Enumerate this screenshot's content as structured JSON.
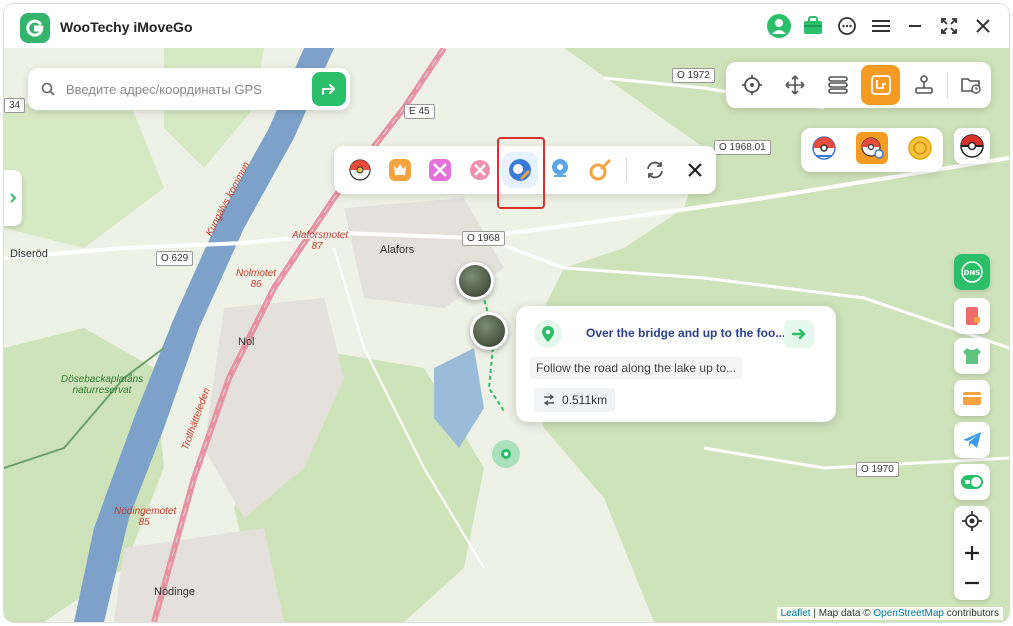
{
  "app": {
    "title": "WooTechy iMoveGo"
  },
  "search": {
    "placeholder": "Введите адрес/координаты GPS"
  },
  "map": {
    "places": [
      {
        "name": "Diseröd",
        "style": "plain"
      },
      {
        "name": "Alafors",
        "style": "plain"
      },
      {
        "name": "Nol",
        "style": "plain"
      },
      {
        "name": "Nödinge",
        "style": "plain"
      },
      {
        "name": "Alaforsmotet 87",
        "style": "red"
      },
      {
        "name": "Nolmotet 86",
        "style": "red"
      },
      {
        "name": "Nödingemotet 85",
        "style": "red"
      },
      {
        "name": "Kungälvs kommun",
        "style": "red"
      },
      {
        "name": "Dösebackaplatåns naturreservat",
        "style": "green"
      },
      {
        "name": "Trollhätteleden",
        "style": "red"
      }
    ],
    "road_badges": [
      "O 1972",
      "E 45",
      "O 1968.01",
      "O 1968",
      "O 629",
      "O 1970",
      "34"
    ]
  },
  "info_card": {
    "title": "Over the bridge and up to the foo...",
    "description": "Follow the road along the lake up to...",
    "distance": "0.511km"
  },
  "attribution": {
    "leaflet": "Leaflet",
    "map_data": " | Map data © ",
    "osm": "OpenStreetMap",
    "contributors": " contributors"
  },
  "colors": {
    "brand_green": "#2bbf6a",
    "active_mode": "#f59a23",
    "highlight_red": "#d9312b",
    "water": "#7da2c9",
    "forest": "#c9dfb4"
  },
  "icons": {
    "titlebar": [
      "avatar-icon",
      "shop-icon",
      "chat-icon",
      "menu-icon",
      "minimize-icon",
      "fullscreen-icon",
      "close-icon"
    ],
    "modes": [
      "teleport-icon",
      "move-icon",
      "multi-spot-icon",
      "jump-route-icon",
      "joystick-icon",
      "history-icon"
    ],
    "games": [
      "pokemon-go-icon",
      "monster-hunter-icon",
      "dragon-quest-icon",
      "pikmin-icon",
      "pokemon-map-icon",
      "location-pin-icon",
      "ingress-icon",
      "refresh-icon",
      "close-icon"
    ],
    "side_tools": [
      "dns-icon",
      "phone-icon",
      "shirt-icon",
      "card-icon",
      "telegram-icon",
      "toggle-icon",
      "locate-icon",
      "zoom-in-icon",
      "zoom-out-icon"
    ]
  }
}
